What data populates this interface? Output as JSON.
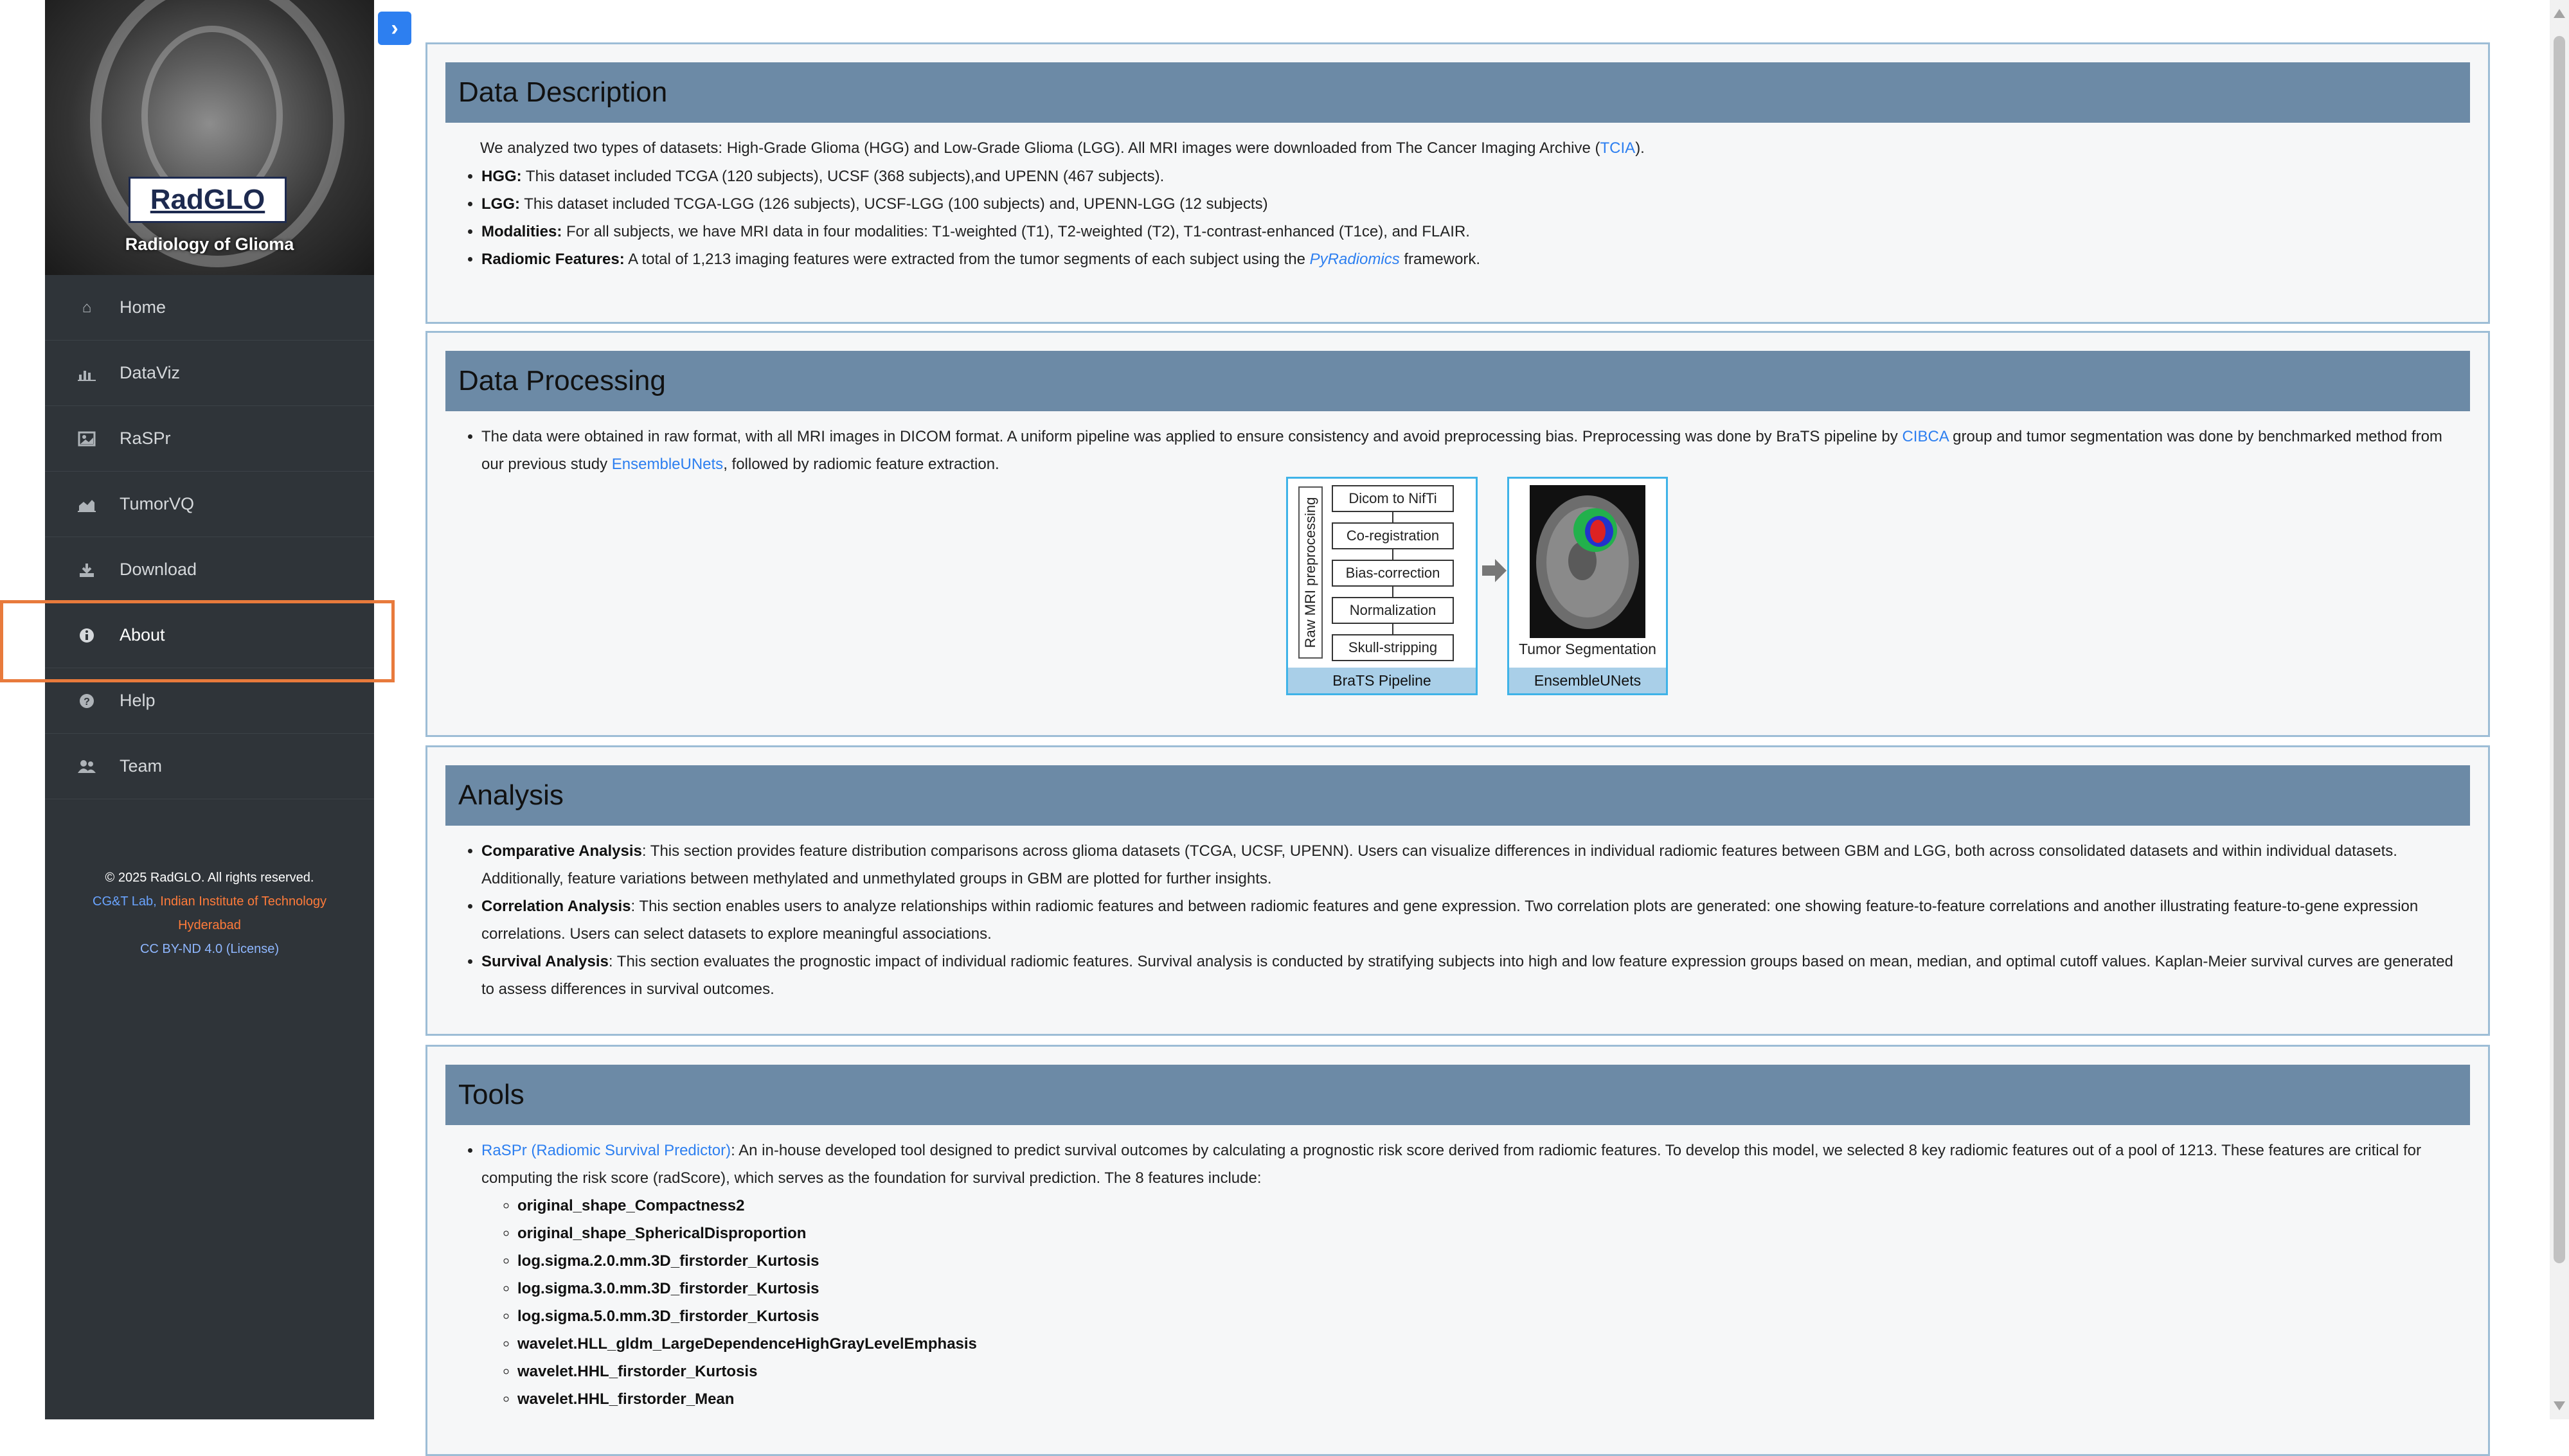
{
  "sidebar": {
    "brand": {
      "logo": "RadGLO",
      "tagline": "Radiology of Glioma"
    },
    "items": [
      {
        "label": "Home",
        "icon": "home-icon"
      },
      {
        "label": "DataViz",
        "icon": "bar-chart-icon"
      },
      {
        "label": "RaSPr",
        "icon": "image-icon"
      },
      {
        "label": "TumorVQ",
        "icon": "area-chart-icon"
      },
      {
        "label": "Download",
        "icon": "download-icon"
      },
      {
        "label": "About",
        "icon": "info-icon"
      },
      {
        "label": "Help",
        "icon": "question-icon"
      },
      {
        "label": "Team",
        "icon": "users-icon"
      }
    ],
    "footer": {
      "copyright": "© 2025 RadGLO. All rights reserved.",
      "lab_prefix": "CG&T Lab,",
      "lab_inst": " Indian Institute of Technology",
      "lab_city": "Hyderabad",
      "license": "CC BY-ND 4.0 (License)"
    }
  },
  "toggle": {
    "icon": "chevron-right-icon",
    "glyph": "›"
  },
  "description": {
    "title": "Data Description",
    "intro": "We analyzed two types of datasets: High-Grade Glioma (HGG) and Low-Grade Glioma (LGG). All MRI images were downloaded from The Cancer Imaging Archive (",
    "intro_link": "TCIA",
    "intro_end": ").",
    "items": [
      {
        "label": "HGG:",
        "text": " This dataset included TCGA (120 subjects), UCSF (368 subjects),and UPENN (467 subjects)."
      },
      {
        "label": "LGG:",
        "text": " This dataset included TCGA-LGG (126 subjects), UCSF-LGG (100 subjects) and, UPENN-LGG (12 subjects)"
      },
      {
        "label": "Modalities:",
        "text": " For all subjects, we have MRI data in four modalities: T1-weighted (T1), T2-weighted (T2), T1-contrast-enhanced (T1ce), and FLAIR."
      }
    ],
    "radiomic_label": "Radiomic Features:",
    "radiomic_text": " A total of 1,213 imaging features were extracted from the tumor segments of each subject using the ",
    "radiomic_link": "PyRadiomics",
    "radiomic_end": " framework."
  },
  "processing": {
    "title": "Data Processing",
    "text1": "The data were obtained in raw format, with all MRI images in DICOM format. A uniform pipeline was applied to ensure consistency and avoid preprocessing bias. Preprocessing was done by BraTS pipeline by ",
    "link1": "CIBCA",
    "text2": " group and tumor segmentation was done by benchmarked method from our previous study ",
    "link2": "EnsembleUNets",
    "text3": ", followed by radiomic feature extraction.",
    "figure": {
      "vertical_label": "Raw MRI preprocessing",
      "steps": [
        "Dicom to NifTi",
        "Co-registration",
        "Bias-correction",
        "Normalization",
        "Skull-stripping"
      ],
      "left_caption": "BraTS Pipeline",
      "right_label": "Tumor Segmentation",
      "right_caption": "EnsembleUNets"
    }
  },
  "analysis": {
    "title": "Analysis",
    "items": [
      {
        "link": "Comparative Analysis",
        "text": ": This section provides feature distribution comparisons across glioma datasets (TCGA, UCSF, UPENN). Users can visualize differences in individual radiomic features between GBM and LGG, both across consolidated datasets and within individual datasets. Additionally, feature variations between methylated and unmethylated groups in GBM are plotted for further insights."
      },
      {
        "link": "Correlation Analysis",
        "text": ": This section enables users to analyze relationships within radiomic features and between radiomic features and gene expression. Two correlation plots are generated: one showing feature-to-feature correlations and another illustrating feature-to-gene expression correlations. Users can select datasets to explore meaningful associations."
      },
      {
        "link": "Survival Analysis",
        "text": ": This section evaluates the prognostic impact of individual radiomic features. Survival analysis is conducted by stratifying subjects into high and low feature expression groups based on mean, median, and optimal cutoff values. Kaplan-Meier survival curves are generated to assess differences in survival outcomes."
      }
    ]
  },
  "tools": {
    "title": "Tools",
    "raspr_link": "RaSPr (Radiomic Survival Predictor)",
    "raspr_text": ": An in-house developed tool designed to predict survival outcomes by calculating a prognostic risk score derived from radiomic features. To develop this model, we selected 8 key radiomic features out of a pool of 1213. These features are critical for computing the risk score (radScore), which serves as the foundation for survival prediction. The 8 features include:",
    "features": [
      "original_shape_Compactness2",
      "original_shape_SphericalDisproportion",
      "log.sigma.2.0.mm.3D_firstorder_Kurtosis",
      "log.sigma.3.0.mm.3D_firstorder_Kurtosis",
      "log.sigma.5.0.mm.3D_firstorder_Kurtosis",
      "wavelet.HLL_gldm_LargeDependenceHighGrayLevelEmphasis",
      "wavelet.HHL_firstorder_Kurtosis",
      "wavelet.HHL_firstorder_Mean"
    ]
  }
}
